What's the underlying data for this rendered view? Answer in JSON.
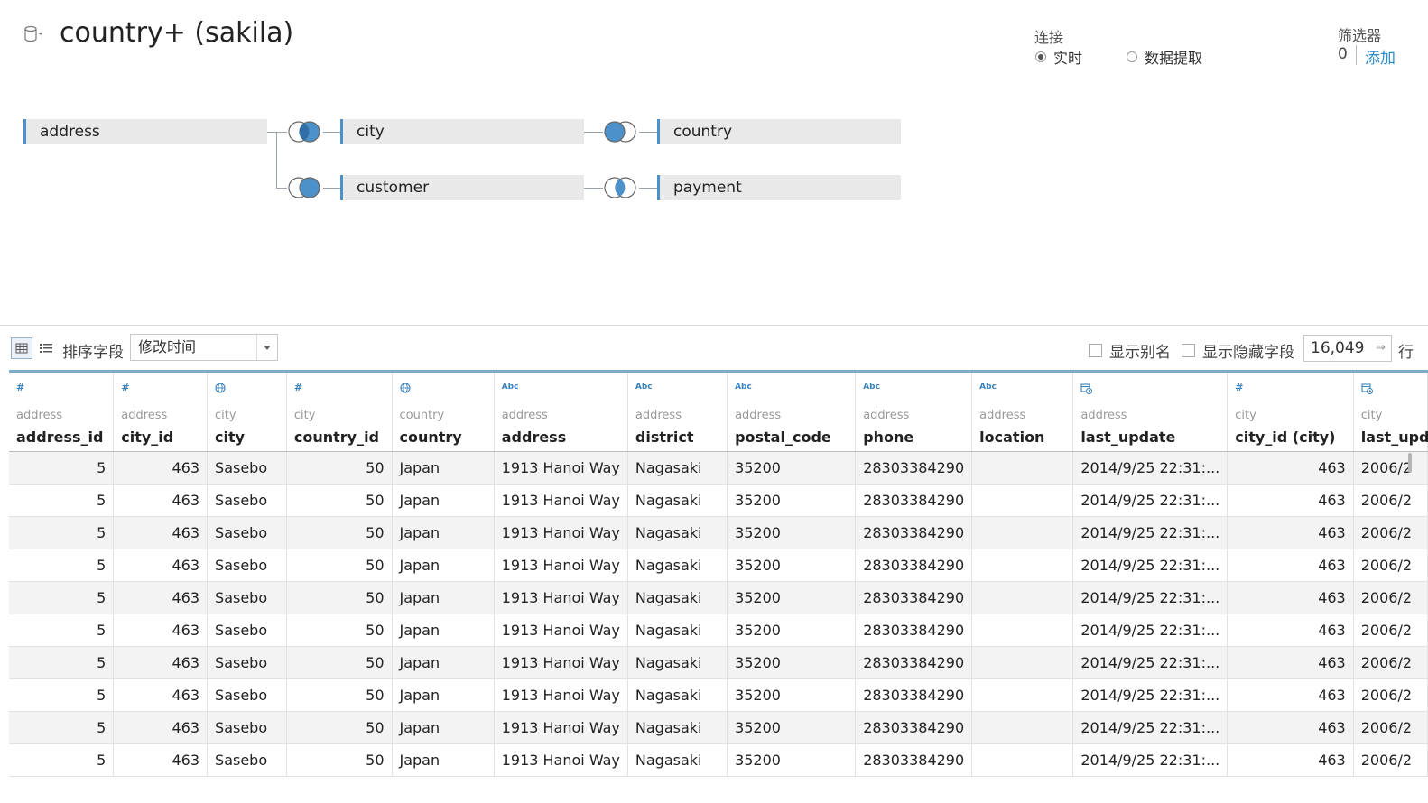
{
  "header": {
    "title": "country+ (sakila)",
    "connection_label": "连接",
    "live_label": "实时",
    "extract_label": "数据提取",
    "filter_label": "筛选器",
    "filter_count": "0",
    "filter_add": "添加"
  },
  "canvas": {
    "tables": [
      "address",
      "city",
      "country",
      "customer",
      "payment"
    ]
  },
  "toolbar": {
    "sort_label": "排序字段",
    "sort_value": "修改时间",
    "show_alias": "显示别名",
    "show_hidden": "显示隐藏字段",
    "row_count": "16,049",
    "rows_label": "行"
  },
  "grid": {
    "columns": [
      {
        "type": "#",
        "source": "address",
        "name": "address_id"
      },
      {
        "type": "#",
        "source": "address",
        "name": "city_id"
      },
      {
        "type": "geo",
        "source": "city",
        "name": "city"
      },
      {
        "type": "#",
        "source": "city",
        "name": "country_id"
      },
      {
        "type": "geo",
        "source": "country",
        "name": "country"
      },
      {
        "type": "Abc",
        "source": "address",
        "name": "address"
      },
      {
        "type": "Abc",
        "source": "address",
        "name": "district"
      },
      {
        "type": "Abc",
        "source": "address",
        "name": "postal_code"
      },
      {
        "type": "Abc",
        "source": "address",
        "name": "phone"
      },
      {
        "type": "Abc",
        "source": "address",
        "name": "location"
      },
      {
        "type": "dt",
        "source": "address",
        "name": "last_update"
      },
      {
        "type": "#",
        "source": "city",
        "name": "city_id (city)"
      },
      {
        "type": "dt",
        "source": "city",
        "name": "last_upd"
      }
    ],
    "rows": [
      [
        "5",
        "463",
        "Sasebo",
        "50",
        "Japan",
        "1913 Hanoi Way",
        "Nagasaki",
        "35200",
        "28303384290",
        "",
        "2014/9/25 22:31:...",
        "463",
        "2006/2"
      ],
      [
        "5",
        "463",
        "Sasebo",
        "50",
        "Japan",
        "1913 Hanoi Way",
        "Nagasaki",
        "35200",
        "28303384290",
        "",
        "2014/9/25 22:31:...",
        "463",
        "2006/2"
      ],
      [
        "5",
        "463",
        "Sasebo",
        "50",
        "Japan",
        "1913 Hanoi Way",
        "Nagasaki",
        "35200",
        "28303384290",
        "",
        "2014/9/25 22:31:...",
        "463",
        "2006/2"
      ],
      [
        "5",
        "463",
        "Sasebo",
        "50",
        "Japan",
        "1913 Hanoi Way",
        "Nagasaki",
        "35200",
        "28303384290",
        "",
        "2014/9/25 22:31:...",
        "463",
        "2006/2"
      ],
      [
        "5",
        "463",
        "Sasebo",
        "50",
        "Japan",
        "1913 Hanoi Way",
        "Nagasaki",
        "35200",
        "28303384290",
        "",
        "2014/9/25 22:31:...",
        "463",
        "2006/2"
      ],
      [
        "5",
        "463",
        "Sasebo",
        "50",
        "Japan",
        "1913 Hanoi Way",
        "Nagasaki",
        "35200",
        "28303384290",
        "",
        "2014/9/25 22:31:...",
        "463",
        "2006/2"
      ],
      [
        "5",
        "463",
        "Sasebo",
        "50",
        "Japan",
        "1913 Hanoi Way",
        "Nagasaki",
        "35200",
        "28303384290",
        "",
        "2014/9/25 22:31:...",
        "463",
        "2006/2"
      ],
      [
        "5",
        "463",
        "Sasebo",
        "50",
        "Japan",
        "1913 Hanoi Way",
        "Nagasaki",
        "35200",
        "28303384290",
        "",
        "2014/9/25 22:31:...",
        "463",
        "2006/2"
      ],
      [
        "5",
        "463",
        "Sasebo",
        "50",
        "Japan",
        "1913 Hanoi Way",
        "Nagasaki",
        "35200",
        "28303384290",
        "",
        "2014/9/25 22:31:...",
        "463",
        "2006/2"
      ],
      [
        "5",
        "463",
        "Sasebo",
        "50",
        "Japan",
        "1913 Hanoi Way",
        "Nagasaki",
        "35200",
        "28303384290",
        "",
        "2014/9/25 22:31:...",
        "463",
        "2006/2"
      ]
    ]
  }
}
